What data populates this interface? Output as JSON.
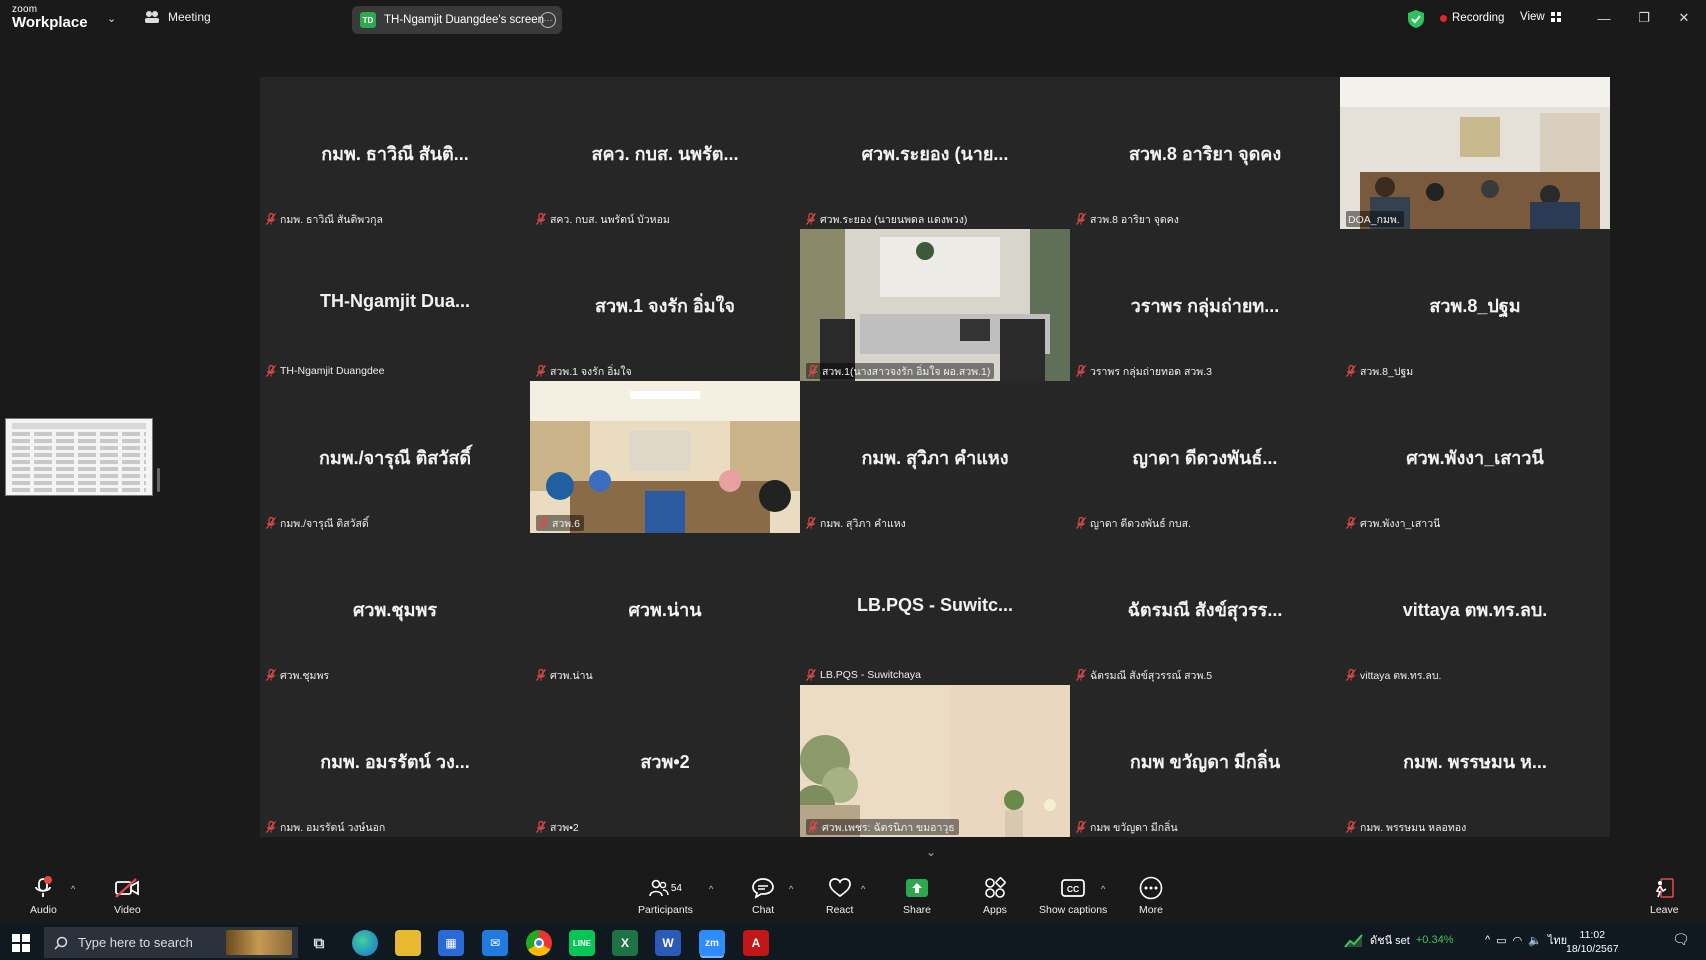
{
  "titlebar": {
    "brand_small": "zoom",
    "brand_big": "Workplace",
    "meeting_label": "Meeting",
    "share_initials": "TD",
    "share_label": "TH-Ngamjit Duangdee's screen",
    "recording_label": "Recording",
    "view_label": "View",
    "icons": [
      "shield-check-icon",
      "minimize-icon",
      "restore-icon",
      "close-icon"
    ]
  },
  "gallery": {
    "rows": [
      [
        {
          "name": "กมพ. ธาวิณี สันติ...",
          "label": "กมพ. ธาวิณี สันติพวกุล",
          "video": false
        },
        {
          "name": "สคว. กบส. นพรัต...",
          "label": "สคว. กบส. นพรัตน์ บัวหอม",
          "video": false
        },
        {
          "name": "ศวพ.ระยอง (นาย...",
          "label": "ศวพ.ระยอง (นายนพดล แดงพวง)",
          "video": false
        },
        {
          "name": "สวพ.8 อาริยา จุดคง",
          "label": "สวพ.8 อาริยา จุดคง",
          "video": false
        },
        {
          "name": "",
          "label": "DOA_กมพ.",
          "video": true,
          "scene": "meeting-room",
          "active": true
        }
      ],
      [
        {
          "name": "TH-Ngamjit Dua...",
          "label": "TH-Ngamjit Duangdee",
          "video": false
        },
        {
          "name": "สวพ.1 จงรัก อิ่มใจ",
          "label": "สวพ.1 จงรัก อิ่มใจ",
          "video": false
        },
        {
          "name": "",
          "label": "สวพ.1(นางสาวจงรัก อิ่มใจ ผอ.สวพ.1)",
          "video": true,
          "scene": "office-room"
        },
        {
          "name": "วราพร กลุ่มถ่ายท...",
          "label": "วราพร กลุ่มถ่ายทอด สวพ.3",
          "video": false
        },
        {
          "name": "สวพ.8_ปฐม",
          "label": "สวพ.8_ปฐม",
          "video": false
        }
      ],
      [
        {
          "name": "กมพ./จารุณี ติสวัสดิ์",
          "label": "กมพ./จารุณี ติสวัสดิ์",
          "video": false
        },
        {
          "name": "",
          "label": "สวพ.6",
          "video": true,
          "scene": "conference-room"
        },
        {
          "name": "กมพ. สุวิภา คำแหง",
          "label": "กมพ. สุวิภา คำแหง",
          "video": false
        },
        {
          "name": "ญาดา ดีดวงพันธ์...",
          "label": "ญาดา ดีดวงพันธ์ กบส.",
          "video": false
        },
        {
          "name": "ศวพ.พังงา_เสาวนี",
          "label": "ศวพ.พังงา_เสาวนี",
          "video": false
        }
      ],
      [
        {
          "name": "ศวพ.ชุมพร",
          "label": "ศวพ.ชุมพร",
          "video": false
        },
        {
          "name": "ศวพ.น่าน",
          "label": "ศวพ.น่าน",
          "video": false
        },
        {
          "name": "LB.PQS - Suwitc...",
          "label": "LB.PQS - Suwitchaya",
          "video": false
        },
        {
          "name": "ฉัตรมณี สังข์สุวรร...",
          "label": "ฉัตรมณี สังข์สุวรรณ์ สวพ.5",
          "video": false
        },
        {
          "name": "vittaya ตพ.ทร.ลบ.",
          "label": "vittaya ตพ.ทร.ลบ.",
          "video": false
        }
      ],
      [
        {
          "name": "กมพ. อมรรัตน์ วง...",
          "label": "กมพ. อมรรัตน์ วงษ์นอก",
          "video": false
        },
        {
          "name": "สวพ•2",
          "label": "สวพ•2",
          "video": false
        },
        {
          "name": "",
          "label": "ศวพ.เพชร: ฉัตรนิภา ขมอาวุธ",
          "video": true,
          "scene": "plant-wall"
        },
        {
          "name": "กมพ ขวัญดา มีกลิ่น",
          "label": "กมพ ขวัญดา มีกลิ่น",
          "video": false
        },
        {
          "name": "กมพ. พรรษมน ห...",
          "label": "กมพ. พรรษมน หลอทอง",
          "video": false
        }
      ]
    ]
  },
  "toolbar": {
    "audio": "Audio",
    "video": "Video",
    "participants": "Participants",
    "participants_count": "54",
    "chat": "Chat",
    "react": "React",
    "share": "Share",
    "apps": "Apps",
    "captions": "Show captions",
    "more": "More",
    "leave": "Leave"
  },
  "taskbar": {
    "search_placeholder": "Type here to search",
    "stock_label": "ดัชนี set",
    "stock_change": "+0.34%",
    "language": "ไทย",
    "time": "11:02",
    "date": "18/10/2567",
    "apps": [
      "task-view-icon",
      "edge-icon",
      "file-explorer-icon",
      "store-icon",
      "mail-icon",
      "chrome-icon",
      "line-icon",
      "excel-icon",
      "word-icon",
      "zoom-icon",
      "acrobat-icon"
    ]
  },
  "colors": {
    "active_speaker": "#2dc25a",
    "recording": "#e02828",
    "muted": "#e24848",
    "share_green": "#2ea84f",
    "stock_up": "#46c35a"
  }
}
